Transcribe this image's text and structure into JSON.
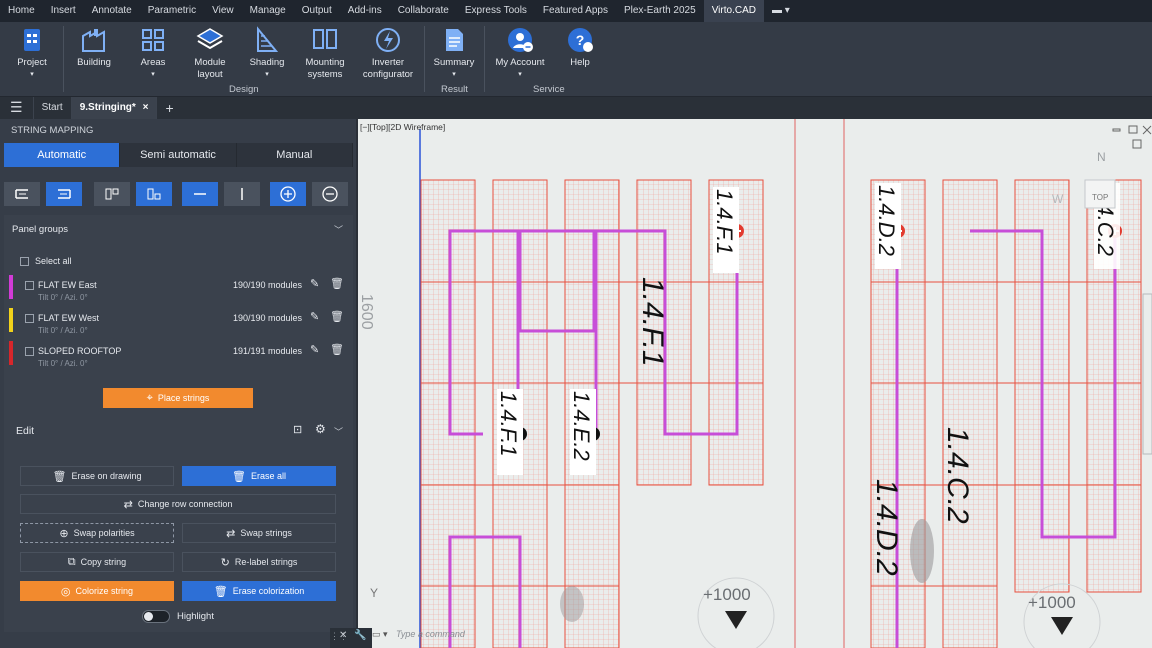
{
  "menubar": {
    "items": [
      "Home",
      "Insert",
      "Annotate",
      "Parametric",
      "View",
      "Manage",
      "Output",
      "Add-ins",
      "Collaborate",
      "Express Tools",
      "Featured Apps",
      "Plex-Earth 2025",
      "Virto.CAD"
    ],
    "active": "Virto.CAD",
    "extra": "▬ ▾"
  },
  "ribbon": {
    "buttons": {
      "project": "Project",
      "building": "Building",
      "areas": "Areas",
      "module_layout": "Module\nlayout",
      "shading": "Shading",
      "mounting": "Mounting\nsystems",
      "inverter": "Inverter\nconfigurator",
      "summary": "Summary",
      "account": "My Account",
      "help": "Help"
    },
    "groups": {
      "design": "Design",
      "result": "Result",
      "service": "Service"
    }
  },
  "tabs": {
    "start": "Start",
    "active": "9.Stringing*",
    "close": "×",
    "add": "+"
  },
  "panel": {
    "title": "STRING MAPPING",
    "modes": [
      "Automatic",
      "Semi automatic",
      "Manual"
    ],
    "active_mode": "Automatic",
    "panel_groups": {
      "title": "Panel groups",
      "select_all": "Select all",
      "groups": [
        {
          "name": "FLAT EW East",
          "sub": "Tilt 0° / Azi. 0°",
          "count": "190/190 modules",
          "color": "#d23bd7"
        },
        {
          "name": "FLAT EW West",
          "sub": "Tilt 0° / Azi. 0°",
          "count": "190/190 modules",
          "color": "#f2d21b"
        },
        {
          "name": "SLOPED ROOFTOP",
          "sub": "Tilt 0° / Azi. 0°",
          "count": "191/191 modules",
          "color": "#d7262b"
        }
      ],
      "place_strings": "Place strings"
    },
    "edit": {
      "title": "Edit",
      "erase_on_drawing": "Erase on drawing",
      "erase_all": "Erase all",
      "change_row": "Change row connection",
      "swap_polarities": "Swap polarities",
      "swap_strings": "Swap strings",
      "copy_string": "Copy string",
      "relabel": "Re-label strings",
      "colorize": "Colorize string",
      "erase_colorization": "Erase colorization",
      "highlight": "Highlight"
    }
  },
  "viewport": {
    "label": "[−][Top][2D Wireframe]",
    "command_placeholder": "Type a command",
    "compass_n": "N",
    "compass_w": "W",
    "viewcube_top": "TOP",
    "dim_label": "1600",
    "y_axis": "Y",
    "coord_labels": [
      "+1000",
      "+1000"
    ],
    "string_labels": [
      "1.4.F.1",
      "1.4.F.1",
      "1.4.F.1",
      "1.4.E.2",
      "1.4.D.2",
      "1.4.D.2",
      "1.4.C.2",
      "1.4.C.2"
    ],
    "colors": {
      "string": "#c74ed8",
      "module": "#e8503e",
      "label_bg": "#ffffff"
    }
  }
}
